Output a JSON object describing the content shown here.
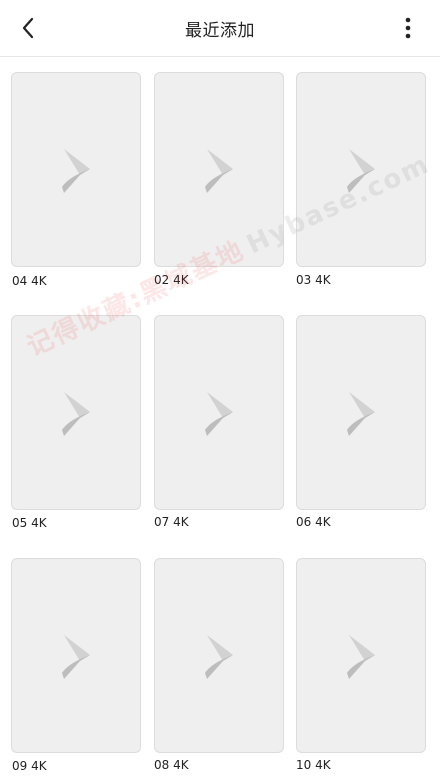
{
  "header": {
    "title": "最近添加",
    "back_icon": "chevron-left-icon",
    "menu_icon": "more-vertical-icon"
  },
  "videos": [
    {
      "label": "04 4K"
    },
    {
      "label": "02 4K"
    },
    {
      "label": "03 4K"
    },
    {
      "label": "05 4K"
    },
    {
      "label": "07 4K"
    },
    {
      "label": "06 4K"
    },
    {
      "label": "09 4K"
    },
    {
      "label": "08 4K"
    },
    {
      "label": "10 4K"
    }
  ],
  "thumbnail_icon": "play-logo-icon",
  "watermark": {
    "text": "记得收藏:黑域基地",
    "site": "Hybase.com"
  },
  "colors": {
    "card_bg": "#efefef",
    "card_border": "#dcdcdc",
    "icon": "#c7c7c7",
    "watermark": "#eb3c3c"
  }
}
